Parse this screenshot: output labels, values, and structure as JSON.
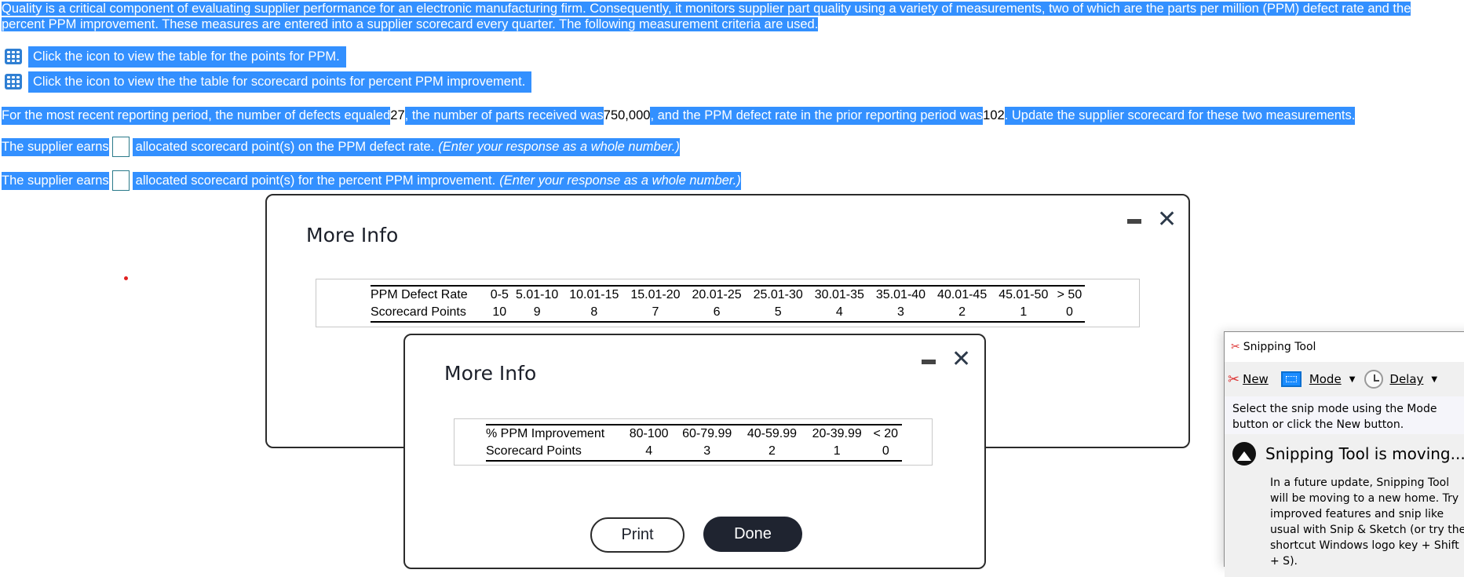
{
  "question": {
    "intro": "Quality is a critical component of evaluating supplier performance for an electronic manufacturing firm. Consequently, it monitors supplier part quality using a variety of measurements, two of which are the parts per million (PPM) defect rate and the percent PPM improvement. These measures are entered into a supplier scorecard every quarter. The following measurement criteria are used.",
    "icon_links": [
      {
        "icon": "table-grid-icon",
        "label": "Click the icon to view the table for the points for PPM."
      },
      {
        "icon": "table-grid-icon",
        "label": "Click the icon to view the the table for scorecard points for percent PPM improvement."
      }
    ],
    "scenario": {
      "part1": "For the most recent reporting period, the number of defects equaled ",
      "defects": "27",
      "part2": ", the number of parts received was ",
      "parts_received": "750,000",
      "part3": ", and the PPM defect rate in the prior reporting period was ",
      "prior_ppm": "102",
      "part4": ". Update the supplier scorecard for these two measurements."
    },
    "answers": [
      {
        "prefix": "The supplier earns",
        "value": "",
        "suffix": "allocated scorecard point(s) on the PPM defect rate.",
        "hint": "(Enter your response as a whole number.)"
      },
      {
        "prefix": "The supplier earns",
        "value": "",
        "suffix": "allocated scorecard point(s) for the percent PPM improvement.",
        "hint": "(Enter your response as a whole number.)"
      }
    ]
  },
  "dialog_ppm": {
    "title": "More Info",
    "minimize_icon": "minimize-icon",
    "close_icon": "close-icon",
    "table": {
      "row_labels": [
        "PPM Defect Rate",
        "Scorecard Points"
      ],
      "ranges": [
        "0-5",
        "5.01-10",
        "10.01-15",
        "15.01-20",
        "20.01-25",
        "25.01-30",
        "30.01-35",
        "35.01-40",
        "40.01-45",
        "45.01-50",
        "> 50"
      ],
      "points": [
        "10",
        "9",
        "8",
        "7",
        "6",
        "5",
        "4",
        "3",
        "2",
        "1",
        "0"
      ]
    }
  },
  "dialog_improvement": {
    "title": "More Info",
    "minimize_icon": "minimize-icon",
    "close_icon": "close-icon",
    "table": {
      "row_labels": [
        "% PPM Improvement",
        "Scorecard Points"
      ],
      "ranges": [
        "80-100",
        "60-79.99",
        "40-59.99",
        "20-39.99",
        "< 20"
      ],
      "points": [
        "4",
        "3",
        "2",
        "1",
        "0"
      ]
    },
    "buttons": {
      "print": "Print",
      "done": "Done"
    }
  },
  "snipping_tool": {
    "title": "Snipping Tool",
    "toolbar": {
      "new": "New",
      "mode": "Mode",
      "delay": "Delay"
    },
    "hint": "Select the snip mode using the Mode button or click the New button.",
    "moving_title": "Snipping Tool is moving...",
    "moving_body": "In a future update, Snipping Tool will be moving to a new home. Try improved features and snip like usual with Snip & Sketch (or try the shortcut Windows logo key + Shift + S)."
  }
}
